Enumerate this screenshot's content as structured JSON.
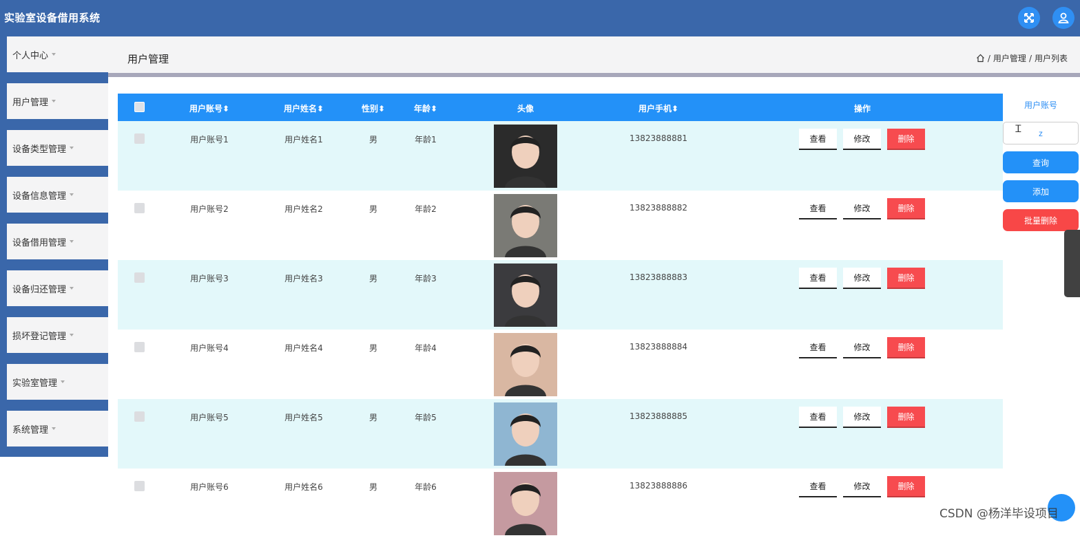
{
  "app": {
    "title": "实验室设备借用系统"
  },
  "topbar": {
    "icons": [
      "fullscreen-icon",
      "user-icon"
    ]
  },
  "sidebar": {
    "items": [
      {
        "label": "个人中心"
      },
      {
        "label": "用户管理"
      },
      {
        "label": "设备类型管理"
      },
      {
        "label": "设备信息管理"
      },
      {
        "label": "设备借用管理"
      },
      {
        "label": "设备归还管理"
      },
      {
        "label": "损坏登记管理"
      },
      {
        "label": "实验室管理"
      },
      {
        "label": "系统管理"
      }
    ]
  },
  "header": {
    "title": "用户管理",
    "breadcrumb": {
      "sep": "/",
      "items": [
        "用户管理",
        "用户列表"
      ]
    }
  },
  "table": {
    "columns": {
      "account": "用户账号",
      "name": "用户姓名",
      "gender": "性别",
      "age": "年龄",
      "avatar": "头像",
      "phone": "用户手机",
      "actions": "操作"
    },
    "rows": [
      {
        "account": "用户账号1",
        "name": "用户姓名1",
        "gender": "男",
        "age": "年龄1",
        "phone": "13823888881",
        "avatar_color": "#2b2b2b"
      },
      {
        "account": "用户账号2",
        "name": "用户姓名2",
        "gender": "男",
        "age": "年龄2",
        "phone": "13823888882",
        "avatar_color": "#7a7a75"
      },
      {
        "account": "用户账号3",
        "name": "用户姓名3",
        "gender": "男",
        "age": "年龄3",
        "phone": "13823888883",
        "avatar_color": "#3b3b3e"
      },
      {
        "account": "用户账号4",
        "name": "用户姓名4",
        "gender": "男",
        "age": "年龄4",
        "phone": "13823888884",
        "avatar_color": "#d9b7a2"
      },
      {
        "account": "用户账号5",
        "name": "用户姓名5",
        "gender": "男",
        "age": "年龄5",
        "phone": "13823888885",
        "avatar_color": "#8fb6d2"
      },
      {
        "account": "用户账号6",
        "name": "用户姓名6",
        "gender": "男",
        "age": "年龄6",
        "phone": "13823888886",
        "avatar_color": "#c59aa0"
      }
    ],
    "actions": {
      "view": "查看",
      "edit": "修改",
      "delete": "删除"
    }
  },
  "search": {
    "label": "用户账号",
    "value": "z",
    "query_label": "查询",
    "add_label": "添加",
    "batch_delete_label": "批量删除"
  },
  "watermark": "CSDN @杨洋毕设项目",
  "colors": {
    "primary": "#3a67aa",
    "accent": "#2391f8",
    "danger": "#f74b4f",
    "row_alt": "#e3f8fa"
  }
}
